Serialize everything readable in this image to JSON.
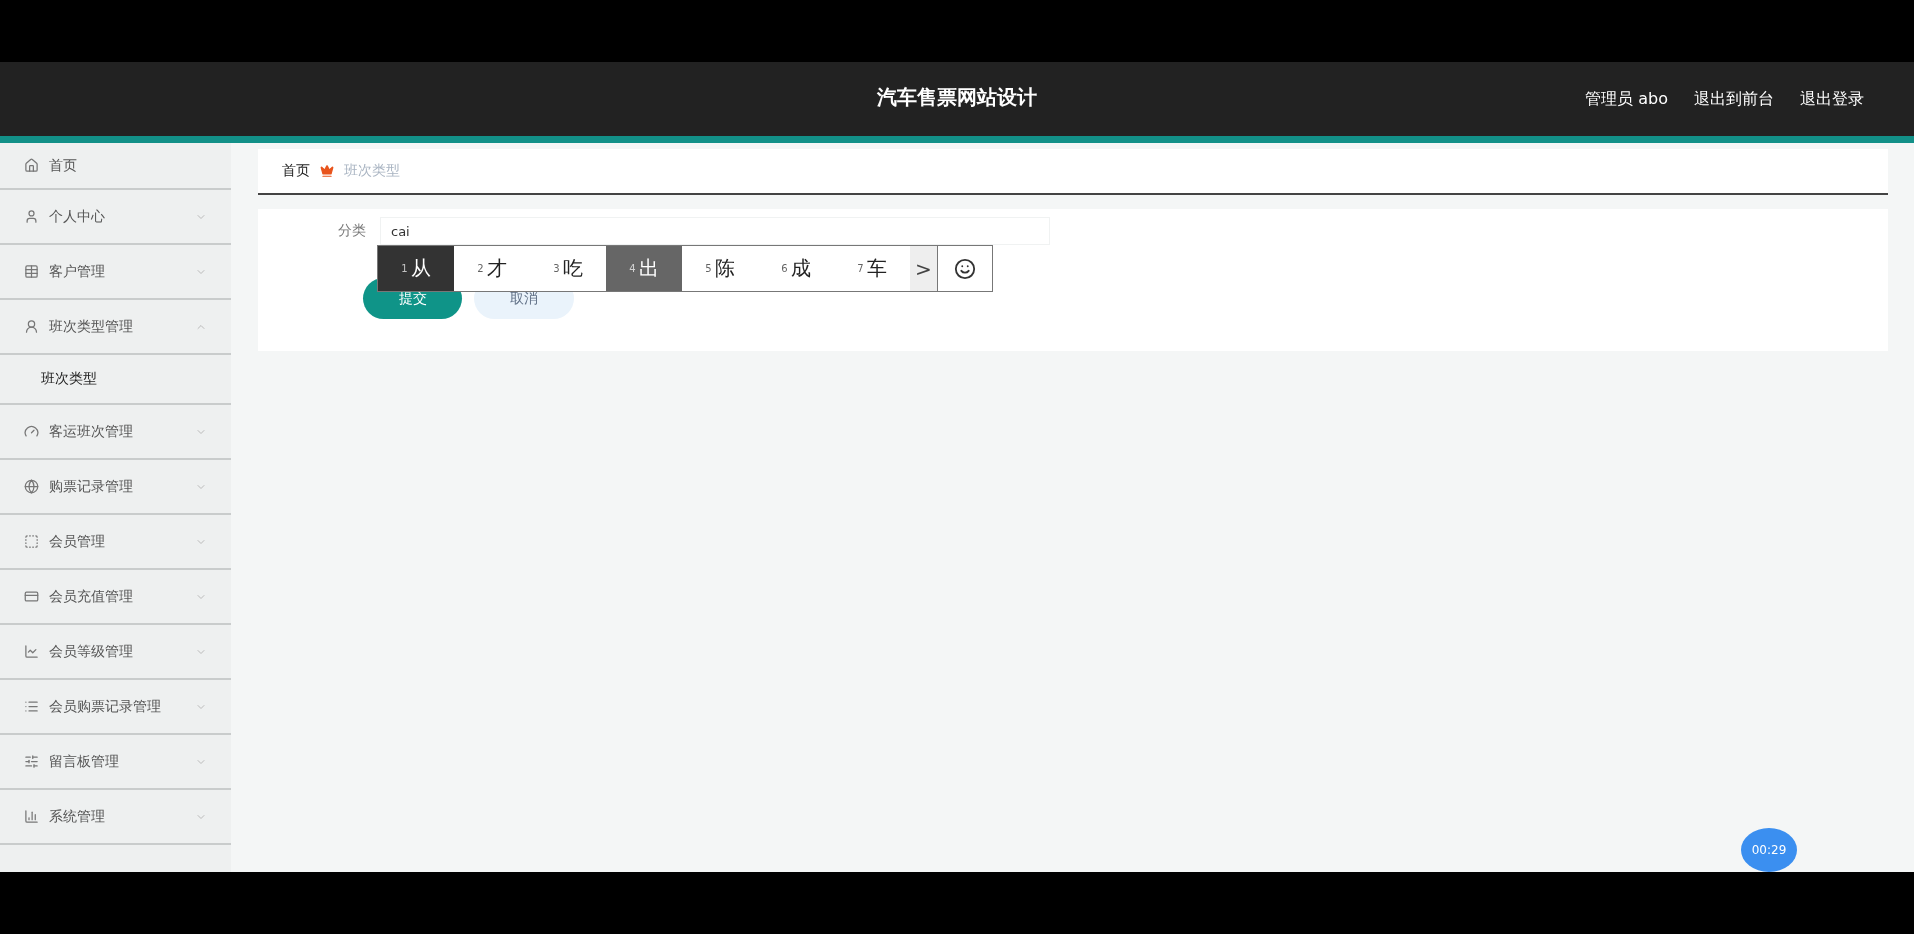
{
  "header": {
    "title": "汽车售票网站设计",
    "user": "管理员 abo",
    "links": [
      "退出到前台",
      "退出登录"
    ]
  },
  "sidebar": {
    "items": [
      {
        "label": "首页",
        "kind": "link"
      },
      {
        "label": "个人中心",
        "kind": "menu",
        "expanded": false
      },
      {
        "label": "客户管理",
        "kind": "menu",
        "expanded": false
      },
      {
        "label": "班次类型管理",
        "kind": "menu",
        "expanded": true,
        "children": [
          {
            "label": "班次类型",
            "selected": true
          }
        ]
      },
      {
        "label": "客运班次管理",
        "kind": "menu",
        "expanded": false
      },
      {
        "label": "购票记录管理",
        "kind": "menu",
        "expanded": false
      },
      {
        "label": "会员管理",
        "kind": "menu",
        "expanded": false
      },
      {
        "label": "会员充值管理",
        "kind": "menu",
        "expanded": false
      },
      {
        "label": "会员等级管理",
        "kind": "menu",
        "expanded": false
      },
      {
        "label": "会员购票记录管理",
        "kind": "menu",
        "expanded": false
      },
      {
        "label": "留言板管理",
        "kind": "menu",
        "expanded": false
      },
      {
        "label": "系统管理",
        "kind": "menu",
        "expanded": false
      }
    ]
  },
  "breadcrumb": [
    {
      "label": "首页",
      "current": false
    },
    {
      "label": "班次类型",
      "current": true
    }
  ],
  "form": {
    "fields": [
      {
        "label": "分类",
        "value": "cai"
      }
    ],
    "buttons": [
      {
        "label": "提交",
        "kind": "primary"
      },
      {
        "label": "取消",
        "kind": "secondary"
      }
    ]
  },
  "ime": {
    "candidates": [
      {
        "index": "1",
        "text": "从",
        "selected": true,
        "hovered": false
      },
      {
        "index": "2",
        "text": "才",
        "selected": false,
        "hovered": false
      },
      {
        "index": "3",
        "text": "吃",
        "selected": false,
        "hovered": false
      },
      {
        "index": "4",
        "text": "出",
        "selected": false,
        "hovered": true
      },
      {
        "index": "5",
        "text": "陈",
        "selected": false,
        "hovered": false
      },
      {
        "index": "6",
        "text": "成",
        "selected": false,
        "hovered": false
      },
      {
        "index": "7",
        "text": "车",
        "selected": false,
        "hovered": false
      }
    ],
    "next": ">"
  },
  "timer": "00:29"
}
